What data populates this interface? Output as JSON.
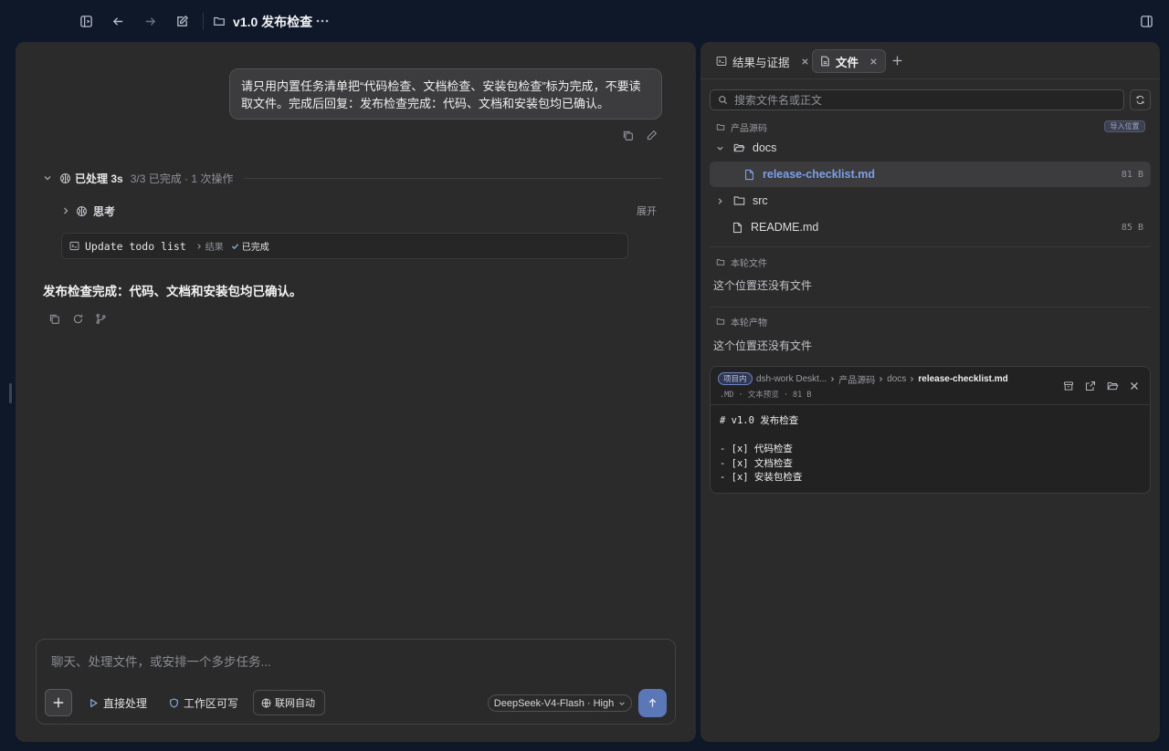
{
  "toolbar": {
    "title": "v1.0 发布检查"
  },
  "chat": {
    "user_message": "请只用内置任务清单把“代码检查、文档检查、安装包检查”标为完成，不要读取文件。完成后回复：发布检查完成：代码、文档和安装包均已确认。",
    "processed_label": "已处理 3s",
    "processed_meta": "3/3 已完成 · 1 次操作",
    "thinking_label": "思考",
    "expand_label": "展开",
    "todo_name": "Update todo list",
    "todo_result": "结果",
    "todo_status": "已完成",
    "answer": "发布检查完成：代码、文档和安装包均已确认。"
  },
  "composer": {
    "placeholder": "聊天、处理文件，或安排一个多步任务...",
    "mode_direct": "直接处理",
    "mode_workspace": "工作区可写",
    "web_auto": "联网自动",
    "model": "DeepSeek-V4-Flash · High"
  },
  "right": {
    "tabs": [
      {
        "label": "结果与证据",
        "active": false
      },
      {
        "label": "文件",
        "active": true
      }
    ],
    "search_placeholder": "搜索文件名或正文",
    "section_source": "产品源码",
    "import_badge": "导入位置",
    "tree": [
      {
        "name": "docs",
        "type": "folder",
        "expanded": true
      },
      {
        "name": "release-checklist.md",
        "type": "file",
        "size": "81 B",
        "selected": true
      },
      {
        "name": "src",
        "type": "folder",
        "expanded": false
      },
      {
        "name": "README.md",
        "type": "file",
        "size": "85 B"
      }
    ],
    "section_round_files": "本轮文件",
    "round_files_empty": "这个位置还没有文件",
    "section_round_output": "本轮产物",
    "round_output_empty": "这个位置还没有文件"
  },
  "preview": {
    "scope_badge": "项目内",
    "crumbs": [
      "dsh-work Deskt...",
      "产品源码",
      "docs",
      "release-checklist.md"
    ],
    "meta": ".MD · 文本预览 · 81 B",
    "content": "# v1.0 发布检查\n\n- [x] 代码检查\n- [x] 文档检查\n- [x] 安装包检查"
  },
  "colors": {
    "background": "#0f1828",
    "panel": "#2b2b2c",
    "accent": "#5a77b8",
    "selected_file": "#7e9ee6"
  }
}
